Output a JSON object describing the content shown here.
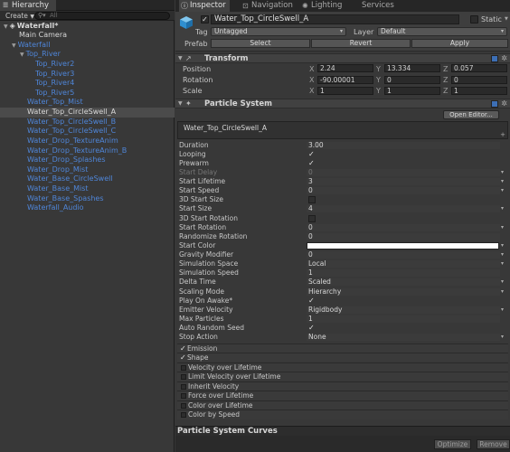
{
  "hierarchy": {
    "tab_label": "Hierarchy",
    "create_label": "Create",
    "search_placeholder": "All",
    "rows": [
      {
        "label": "Waterfall*",
        "indent": 0,
        "color": "white",
        "expanded": true,
        "scene": true
      },
      {
        "label": "Main Camera",
        "indent": 1,
        "color": "white"
      },
      {
        "label": "Waterfall",
        "indent": 1,
        "color": "blue",
        "expanded": true
      },
      {
        "label": "Top_River",
        "indent": 2,
        "color": "blue",
        "expanded": true
      },
      {
        "label": "Top_River2",
        "indent": 3,
        "color": "blue"
      },
      {
        "label": "Top_River3",
        "indent": 3,
        "color": "blue"
      },
      {
        "label": "Top_River4",
        "indent": 3,
        "color": "blue"
      },
      {
        "label": "Top_River5",
        "indent": 3,
        "color": "blue"
      },
      {
        "label": "Water_Top_Mist",
        "indent": 2,
        "color": "blue"
      },
      {
        "label": "Water_Top_CircleSwell_A",
        "indent": 2,
        "color": "white",
        "selected": true
      },
      {
        "label": "Water_Top_CircleSwell_B",
        "indent": 2,
        "color": "blue"
      },
      {
        "label": "Water_Top_CircleSwell_C",
        "indent": 2,
        "color": "blue"
      },
      {
        "label": "Water_Drop_TextureAnim",
        "indent": 2,
        "color": "blue"
      },
      {
        "label": "Water_Drop_TextureAnim_B",
        "indent": 2,
        "color": "blue"
      },
      {
        "label": "Water_Drop_Splashes",
        "indent": 2,
        "color": "blue"
      },
      {
        "label": "Water_Drop_Mist",
        "indent": 2,
        "color": "blue"
      },
      {
        "label": "Water_Base_CircleSwell",
        "indent": 2,
        "color": "blue"
      },
      {
        "label": "Water_Base_Mist",
        "indent": 2,
        "color": "blue"
      },
      {
        "label": "Water_Base_Spashes",
        "indent": 2,
        "color": "blue"
      },
      {
        "label": "Waterfall_Audio",
        "indent": 2,
        "color": "blue"
      }
    ]
  },
  "inspector_tabs": [
    {
      "label": "Inspector",
      "icon": "info-icon",
      "active": true
    },
    {
      "label": "Navigation",
      "icon": "navigation-icon"
    },
    {
      "label": "Lighting",
      "icon": "lighting-icon"
    },
    {
      "label": "Services",
      "icon": ""
    }
  ],
  "object": {
    "name": "Water_Top_CircleSwell_A",
    "static_label": "Static",
    "tag_label": "Tag",
    "tag_value": "Untagged",
    "layer_label": "Layer",
    "layer_value": "Default",
    "prefab_label": "Prefab",
    "prefab_buttons": [
      "Select",
      "Revert",
      "Apply"
    ]
  },
  "transform": {
    "title": "Transform",
    "rows": [
      {
        "label": "Position",
        "x": "2.24",
        "y": "13.334",
        "z": "0.057"
      },
      {
        "label": "Rotation",
        "x": "-90.00001",
        "y": "0",
        "z": "0"
      },
      {
        "label": "Scale",
        "x": "1",
        "y": "1",
        "z": "1"
      }
    ],
    "axis_labels": [
      "X",
      "Y",
      "Z"
    ]
  },
  "particle_system": {
    "title": "Particle System",
    "open_editor_label": "Open Editor...",
    "system_name": "Water_Top_CircleSwell_A",
    "properties": [
      {
        "label": "Duration",
        "value": "3.00",
        "kind": "text"
      },
      {
        "label": "Looping",
        "value": "✓",
        "kind": "check"
      },
      {
        "label": "Prewarm",
        "value": "✓",
        "kind": "check"
      },
      {
        "label": "Start Delay",
        "value": "0",
        "kind": "dropdown",
        "dim": true
      },
      {
        "label": "Start Lifetime",
        "value": "3",
        "kind": "dropdown"
      },
      {
        "label": "Start Speed",
        "value": "0",
        "kind": "dropdown"
      },
      {
        "label": "3D Start Size",
        "value": "",
        "kind": "emptycheck"
      },
      {
        "label": "Start Size",
        "value": "4",
        "kind": "dropdown"
      },
      {
        "label": "3D Start Rotation",
        "value": "",
        "kind": "emptycheck"
      },
      {
        "label": "Start Rotation",
        "value": "0",
        "kind": "dropdown"
      },
      {
        "label": "Randomize Rotation",
        "value": "0",
        "kind": "text"
      },
      {
        "label": "Start Color",
        "value": "#ffffff",
        "kind": "color"
      },
      {
        "label": "Gravity Modifier",
        "value": "0",
        "kind": "dropdown"
      },
      {
        "label": "Simulation Space",
        "value": "Local",
        "kind": "dropdown"
      },
      {
        "label": "Simulation Speed",
        "value": "1",
        "kind": "text"
      },
      {
        "label": "Delta Time",
        "value": "Scaled",
        "kind": "dropdown"
      },
      {
        "label": "Scaling Mode",
        "value": "Hierarchy",
        "kind": "dropdown"
      },
      {
        "label": "Play On Awake*",
        "value": "✓",
        "kind": "check"
      },
      {
        "label": "Emitter Velocity",
        "value": "Rigidbody",
        "kind": "dropdown"
      },
      {
        "label": "Max Particles",
        "value": "1",
        "kind": "text"
      },
      {
        "label": "Auto Random Seed",
        "value": "✓",
        "kind": "check"
      },
      {
        "label": "Stop Action",
        "value": "None",
        "kind": "dropdown"
      }
    ],
    "modules": [
      {
        "label": "Emission",
        "enabled": true
      },
      {
        "label": "Shape",
        "enabled": true
      },
      {
        "label": "Velocity over Lifetime",
        "enabled": false
      },
      {
        "label": "Limit Velocity over Lifetime",
        "enabled": false
      },
      {
        "label": "Inherit Velocity",
        "enabled": false
      },
      {
        "label": "Force over Lifetime",
        "enabled": false
      },
      {
        "label": "Color over Lifetime",
        "enabled": false
      },
      {
        "label": "Color by Speed",
        "enabled": false
      }
    ]
  },
  "curves": {
    "title": "Particle System Curves",
    "buttons": [
      "Optimize",
      "Remove"
    ]
  },
  "colors": {
    "panel": "#383838",
    "hierarchy_blue": "#4f86d9",
    "selection": "#4b4b4b",
    "accent_bookmark": "#3d6fb5"
  }
}
